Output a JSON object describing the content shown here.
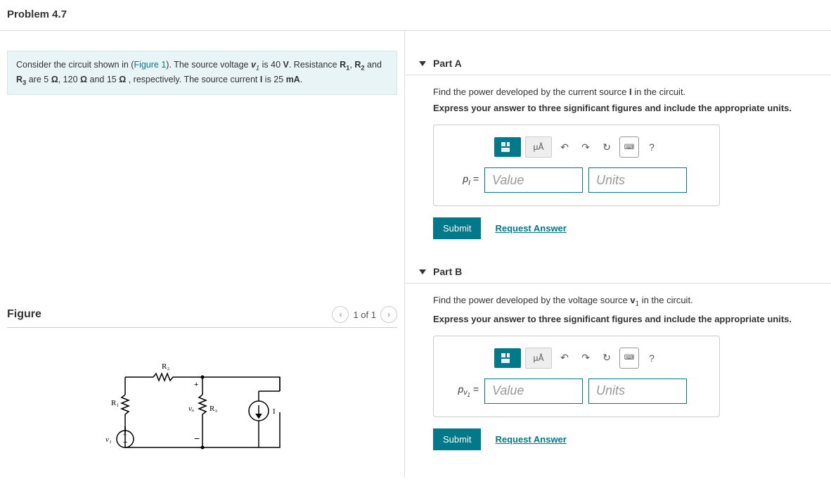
{
  "title": "Problem 4.7",
  "problem": {
    "prefix": "Consider the circuit shown in (",
    "figure_link": "Figure 1",
    "mid1": "). The source voltage ",
    "v1_sym": "v",
    "v1_sub": "1",
    "mid2": " is 40 ",
    "volt": "V",
    "mid3": ". Resistance ",
    "R1": "R",
    "R1_sub": "1",
    "mid4": ", ",
    "R2": "R",
    "R2_sub": "2",
    "mid5": " and ",
    "R3": "R",
    "R3_sub": "3",
    "mid6": " are 5 ",
    "ohm1": "Ω",
    "mid7": ", 120 ",
    "ohm2": "Ω",
    "mid8": " and 15 ",
    "ohm3": "Ω",
    "mid9": " , respectively. The source current ",
    "Ibold": "I",
    "mid10": " is 25 ",
    "mA": "mA",
    "mid11": "."
  },
  "figure": {
    "title": "Figure",
    "pager": "1 of 1"
  },
  "circuit_labels": {
    "R1": "R₁",
    "R2": "R₂",
    "R3": "R₃",
    "v1": "v₁",
    "vo": "vₒ",
    "I": "I",
    "plus": "+",
    "minus": "−"
  },
  "parts": {
    "A": {
      "header": "Part A",
      "prompt_pre": "Find the power developed by the current source ",
      "prompt_sym": "I",
      "prompt_post": " in the circuit.",
      "instr": "Express your answer to three significant figures and include the appropriate units.",
      "var_label": "pI",
      "var_label_html_pre": "p",
      "var_label_html_sub": "I",
      "eq": " =",
      "value_ph": "Value",
      "units_ph": "Units",
      "submit": "Submit",
      "request": "Request Answer",
      "tool_ua": "μÅ",
      "tool_help": "?"
    },
    "B": {
      "header": "Part B",
      "prompt_pre": "Find the power developed by the voltage source ",
      "prompt_sym_v": "v",
      "prompt_sym_sub": "1",
      "prompt_post": " in the circuit.",
      "instr": "Express your answer to three significant figures and include the appropriate units.",
      "var_label_html_pre": "p",
      "var_label_html_sub_v": "v",
      "var_label_html_sub_1": "1",
      "eq": " =",
      "value_ph": "Value",
      "units_ph": "Units",
      "submit": "Submit",
      "request": "Request Answer",
      "tool_ua": "μÅ",
      "tool_help": "?"
    }
  }
}
